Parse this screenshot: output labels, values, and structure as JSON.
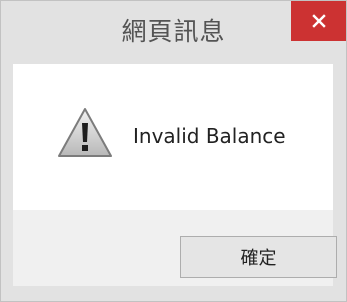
{
  "window": {
    "title": "網頁訊息",
    "close_icon": "close-icon"
  },
  "message": {
    "icon": "warning-icon",
    "text": "Invalid Balance"
  },
  "buttons": {
    "ok_label": "確定"
  },
  "colors": {
    "titlebar": "#e2e2e2",
    "close_button": "#cc3232",
    "content_background": "#ffffff",
    "footer_background": "#f0f0f0"
  }
}
